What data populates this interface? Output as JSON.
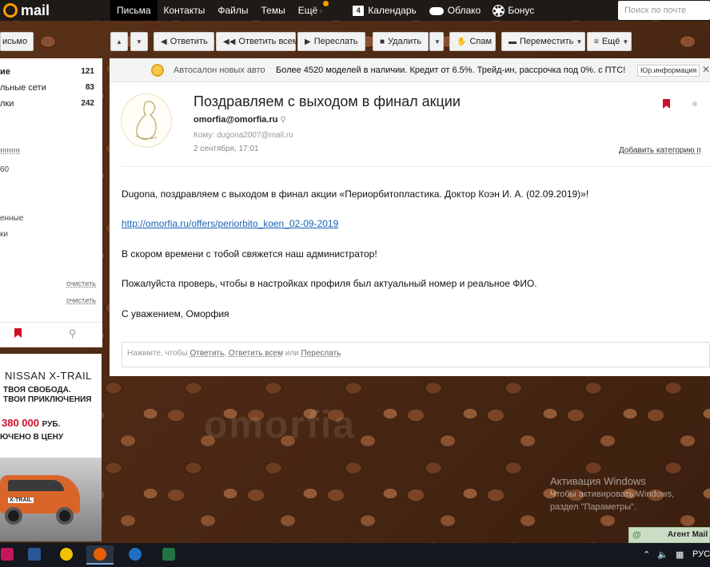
{
  "topbar": {
    "logo_text": "mail",
    "nav": [
      {
        "label": "Письма",
        "active": true
      },
      {
        "label": "Контакты",
        "active": false
      },
      {
        "label": "Файлы",
        "active": false
      },
      {
        "label": "Темы",
        "active": false
      },
      {
        "label": "Ещё",
        "active": false
      }
    ],
    "services": [
      {
        "label": "Календарь",
        "icon": "calendar-icon",
        "badge": "4"
      },
      {
        "label": "Облако",
        "icon": "cloud-icon"
      },
      {
        "label": "Бонус",
        "icon": "gear-icon"
      }
    ],
    "search_placeholder": "Поиск по почте"
  },
  "toolbar": {
    "compose_label": "исьмо",
    "reply": "Ответить",
    "reply_all": "Ответить всем",
    "forward": "Переслать",
    "delete": "Удалить",
    "spam": "Спам",
    "move": "Переместить",
    "more": "Ещё"
  },
  "sidebar": {
    "folders": [
      {
        "label": "ие",
        "count": "121",
        "bold": true
      },
      {
        "label": "льные сети",
        "count": "83",
        "bold": false
      },
      {
        "label": "лки",
        "count": "242",
        "bold": false
      }
    ],
    "extra_lines": [
      "!!!!!!!!!",
      "60",
      "енные",
      "ки"
    ],
    "clean_label": "очистить",
    "clean_label_2": "очистить"
  },
  "ad": {
    "title": "NISSAN X-TRAIL",
    "slogan_1": "ТВОЯ СВОБОДА.",
    "slogan_2": "ТВОИ ПРИКЛЮЧЕНИЯ",
    "price": "380 000",
    "price_suffix": "РУБ.",
    "included": "ЮЧЕНО В ЦЕНУ",
    "plate": "X-TRAIL"
  },
  "adbar": {
    "sender": "Автосалон новых авто",
    "text": "Более 4520 моделей в наличии. Кредит от 6.5%. Трейд-ин, рассрочка под 0%. с ПТС!",
    "badge": "Юр.информация"
  },
  "message": {
    "subject": "Поздравляем с выходом в финал акции",
    "from": "omorfia@omorfia.ru",
    "to_prefix": "Кому:",
    "to": "dugona2007@mail.ru",
    "date": "2 сентября, 17:01",
    "add_category": "Добавить категорию п",
    "body": [
      {
        "type": "text",
        "text": "Dugona, поздравляем с выходом в финал акции «Периорбитопластика. Доктор Коэн И. А. (02.09.2019)»!"
      },
      {
        "type": "link",
        "text": "http://omorfia.ru/offers/periorbito_koen_02-09-2019"
      },
      {
        "type": "text",
        "text": "В скором времени с тобой свяжется наш администратор!"
      },
      {
        "type": "text",
        "text": "Пожалуйста проверь, чтобы в настройках профиля был актуальный номер и реальное ФИО."
      },
      {
        "type": "text",
        "text": "С уважением, Оморфия"
      }
    ]
  },
  "quick_reply": {
    "prefix": "Нажмите, чтобы",
    "reply": "Ответить",
    "sep": ",",
    "reply_all": "Ответить всем",
    "or": "или",
    "forward": "Переслать"
  },
  "watermark": "omorfia",
  "activation": {
    "title": "Активация Windows",
    "subtitle_1": "Чтобы активировать Windows,",
    "subtitle_2": "раздел \"Параметры\"."
  },
  "agent": {
    "label": "Агент Mail"
  },
  "taskbar": {
    "apps": [
      "word-icon",
      "onec-icon",
      "firefox-icon",
      "thunderbird-icon",
      "excel-icon"
    ],
    "lang": "РУС"
  },
  "colors": {
    "accent": "#ff9e00",
    "flag": "#d0102a",
    "link": "#1a64b4"
  }
}
